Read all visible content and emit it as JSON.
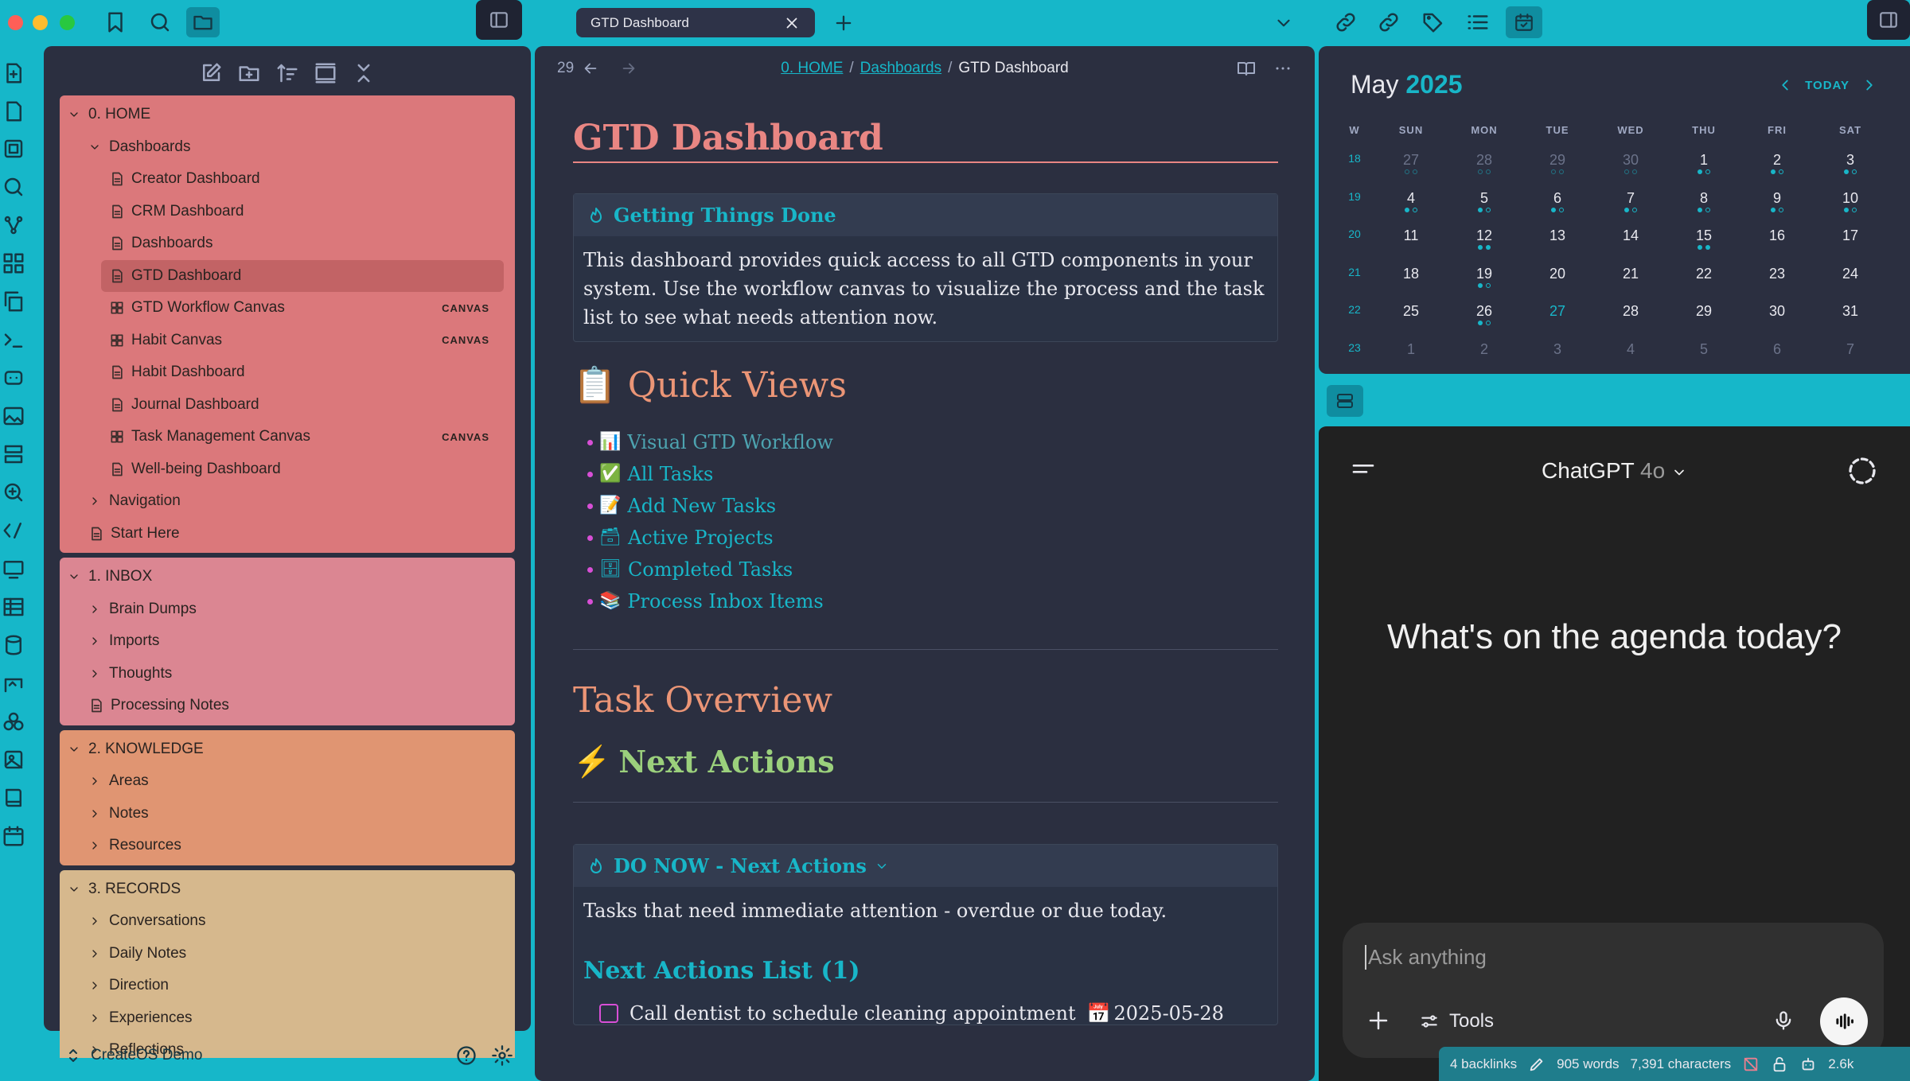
{
  "tab": {
    "title": "GTD Dashboard"
  },
  "nav": {
    "back_count": "29",
    "crumbs": [
      "0. HOME",
      "Dashboards",
      "GTD Dashboard"
    ]
  },
  "sidebar": {
    "groups": [
      {
        "label": "0. HOME",
        "items": [
          {
            "label": "Dashboards",
            "type": "folder"
          },
          {
            "label": "Creator Dashboard",
            "type": "file"
          },
          {
            "label": "CRM Dashboard",
            "type": "file"
          },
          {
            "label": "Dashboards",
            "type": "file"
          },
          {
            "label": "GTD Dashboard",
            "type": "file",
            "selected": true
          },
          {
            "label": "GTD Workflow Canvas",
            "type": "canvas",
            "badge": "CANVAS"
          },
          {
            "label": "Habit Canvas",
            "type": "canvas",
            "badge": "CANVAS"
          },
          {
            "label": "Habit Dashboard",
            "type": "file"
          },
          {
            "label": "Journal Dashboard",
            "type": "file"
          },
          {
            "label": "Task Management Canvas",
            "type": "canvas",
            "badge": "CANVAS"
          },
          {
            "label": "Well-being Dashboard",
            "type": "file"
          },
          {
            "label": "Navigation",
            "type": "folder-closed"
          },
          {
            "label": "Start Here",
            "type": "file-root"
          }
        ]
      },
      {
        "label": "1. INBOX",
        "items": [
          {
            "label": "Brain Dumps"
          },
          {
            "label": "Imports"
          },
          {
            "label": "Thoughts"
          },
          {
            "label": "Processing Notes",
            "type": "file"
          }
        ]
      },
      {
        "label": "2. KNOWLEDGE",
        "items": [
          {
            "label": "Areas"
          },
          {
            "label": "Notes"
          },
          {
            "label": "Resources"
          }
        ]
      },
      {
        "label": "3. RECORDS",
        "items": [
          {
            "label": "Conversations"
          },
          {
            "label": "Daily Notes"
          },
          {
            "label": "Direction"
          },
          {
            "label": "Experiences"
          },
          {
            "label": "Reflections"
          }
        ]
      }
    ],
    "vault_name": "CreateOS Demo"
  },
  "note": {
    "title": "GTD Dashboard",
    "callout1_title": "Getting Things Done",
    "callout1_body": "This dashboard provides quick access to all GTD components in your system. Use the workflow canvas to visualize the process and the task list to see what needs attention now.",
    "quick_views_title": "Quick Views",
    "quick_views_emoji": "📋",
    "links": [
      {
        "emoji": "📊",
        "label": "Visual GTD Workflow"
      },
      {
        "emoji": "✅",
        "label": "All Tasks"
      },
      {
        "emoji": "📝",
        "label": "Add New Tasks"
      },
      {
        "emoji": "🗃",
        "label": "Active Projects"
      },
      {
        "emoji": "🗄",
        "label": "Completed Tasks"
      },
      {
        "emoji": "📚",
        "label": "Process Inbox Items"
      }
    ],
    "task_overview": "Task Overview",
    "next_actions": "Next Actions",
    "next_actions_emoji": "⚡",
    "callout2_title": "DO NOW - Next Actions",
    "callout2_body": "Tasks that need immediate attention - overdue or due today.",
    "list_title": "Next Actions List (1)",
    "task": "Call dentist to schedule cleaning appointment",
    "task_date_emoji": "📅",
    "task_date": "2025-05-28"
  },
  "calendar": {
    "month": "May",
    "year": "2025",
    "today_label": "TODAY",
    "headers": [
      "W",
      "SUN",
      "MON",
      "TUE",
      "WED",
      "THU",
      "FRI",
      "SAT"
    ],
    "weeks": [
      {
        "w": "18",
        "days": [
          "27",
          "28",
          "29",
          "30",
          "1",
          "2",
          "3"
        ]
      },
      {
        "w": "19",
        "days": [
          "4",
          "5",
          "6",
          "7",
          "8",
          "9",
          "10"
        ]
      },
      {
        "w": "20",
        "days": [
          "11",
          "12",
          "13",
          "14",
          "15",
          "16",
          "17"
        ]
      },
      {
        "w": "21",
        "days": [
          "18",
          "19",
          "20",
          "21",
          "22",
          "23",
          "24"
        ]
      },
      {
        "w": "22",
        "days": [
          "25",
          "26",
          "27",
          "28",
          "29",
          "30",
          "31"
        ]
      },
      {
        "w": "23",
        "days": [
          "1",
          "2",
          "3",
          "4",
          "5",
          "6",
          "7"
        ]
      }
    ]
  },
  "chat": {
    "model_name": "ChatGPT",
    "model_version": "4o",
    "hero": "What's on the agenda today?",
    "placeholder": "Ask anything",
    "tools_label": "Tools"
  },
  "status": {
    "backlinks": "4 backlinks",
    "words": "905 words",
    "characters": "7,391 characters",
    "tokens": "2.6k"
  },
  "colors": {
    "accent": "#16b7c9",
    "bg": "#2b2f40",
    "home": "#db787b",
    "inbox": "#db8692",
    "knowledge": "#e09572",
    "records": "#d6b88d"
  }
}
